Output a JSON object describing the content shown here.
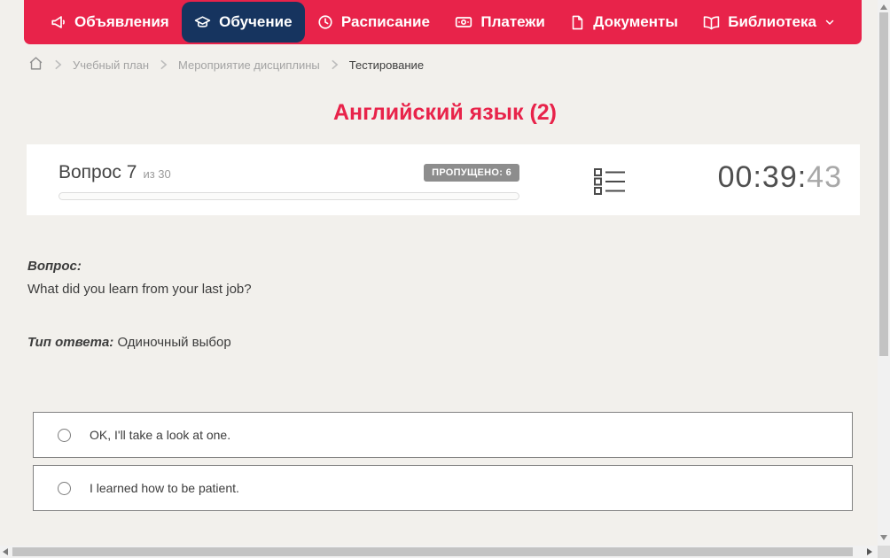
{
  "colors": {
    "accent_red": "#e8234a",
    "active_tab_navy": "#16345f",
    "page_background": "#f2f0ec",
    "badge_gray": "#8d8d8d"
  },
  "nav": {
    "tabs": [
      {
        "label": "Объявления",
        "icon": "megaphone-icon",
        "active": false
      },
      {
        "label": "Обучение",
        "icon": "graduation-cap-icon",
        "active": true
      },
      {
        "label": "Расписание",
        "icon": "clock-icon",
        "active": false
      },
      {
        "label": "Платежи",
        "icon": "cash-icon",
        "active": false
      },
      {
        "label": "Документы",
        "icon": "document-icon",
        "active": false
      },
      {
        "label": "Библиотека",
        "icon": "open-book-icon",
        "active": false,
        "has_dropdown": true
      }
    ]
  },
  "breadcrumb": {
    "home_icon": "home-icon",
    "items": [
      {
        "label": "Учебный план",
        "current": false
      },
      {
        "label": "Мероприятие дисциплины",
        "current": false
      },
      {
        "label": "Тестирование",
        "current": true
      }
    ]
  },
  "page": {
    "title": "Английский язык (2)"
  },
  "question_panel": {
    "question_label": "Вопрос 7",
    "question_of": "из 30",
    "skipped_badge": "ПРОПУЩЕНО: 6",
    "progress_percent": 0,
    "list_icon": "question-list-icon",
    "timer_main": "00:39:",
    "timer_seconds": "43"
  },
  "question": {
    "label": "Вопрос:",
    "text": "What did you learn from your last job?",
    "type_label": "Тип ответа:",
    "type_value": "Одиночный выбор"
  },
  "answers": {
    "options": [
      {
        "text": "OK, I'll take a look at one.",
        "selected": false
      },
      {
        "text": "I learned how to be patient.",
        "selected": false
      }
    ]
  }
}
